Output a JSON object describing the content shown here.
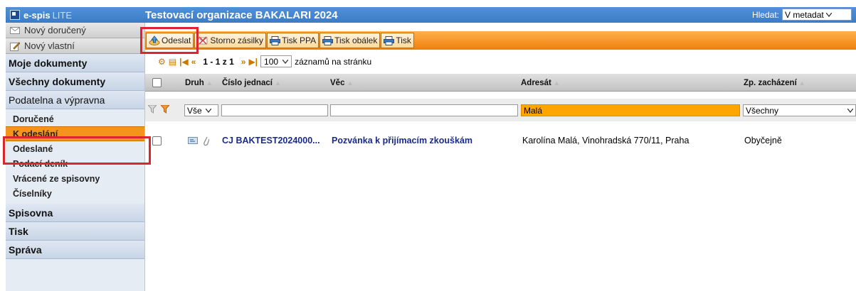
{
  "header": {
    "logo_text": "e-spis",
    "logo_lite": "LITE",
    "org_title": "Testovací organizace BAKALARI 2024",
    "search_label": "Hledat:",
    "search_scope": "V metadat"
  },
  "sidebar": {
    "buttons": [
      {
        "label": "Nový doručený",
        "icon": "envelope-icon"
      },
      {
        "label": "Nový vlastní",
        "icon": "pencil-icon"
      }
    ],
    "sections": {
      "moje": "Moje dokumenty",
      "vsechny": "Všechny dokumenty",
      "podatelna": "Podatelna a výpravna",
      "spisovna": "Spisovna",
      "tisk": "Tisk",
      "sprava": "Správa"
    },
    "sub_items": [
      {
        "label": "Doručené"
      },
      {
        "label": "K odeslání"
      },
      {
        "label": "Odeslané"
      },
      {
        "label": "Podací deník"
      },
      {
        "label": "Vrácené ze spisovny"
      },
      {
        "label": "Číselníky"
      }
    ]
  },
  "toolbar": {
    "odeslat": "Odeslat",
    "storno": "Storno zásilky",
    "tisk_ppa": "Tisk PPA",
    "tisk_obalek": "Tisk obálek",
    "tisk": "Tisk"
  },
  "pager": {
    "range": "1 - 1 z 1",
    "page_size": "100",
    "per_page_label": "záznamů na stránku"
  },
  "table": {
    "headers": {
      "druh": "Druh",
      "cislo": "Číslo jednací",
      "vec": "Věc",
      "adresat": "Adresát",
      "zp": "Zp. zacházení"
    },
    "filters": {
      "druh": "Vše",
      "cislo": "",
      "vec": "",
      "adresat": "Malá",
      "zp": "Všechny"
    },
    "rows": [
      {
        "cislo": "CJ BAKTEST2024000...",
        "vec": "Pozvánka k přijímacím zkouškám",
        "adresat": "Karolína Malá, Vinohradská 770/11, Praha",
        "zp": "Obyčejně"
      }
    ]
  },
  "colors": {
    "header_blue": "#3c7cc6",
    "toolbar_orange": "#f07f0b",
    "active_item": "#f5941c",
    "filter_highlight": "#ffa500",
    "highlight_box": "#d9262f"
  }
}
